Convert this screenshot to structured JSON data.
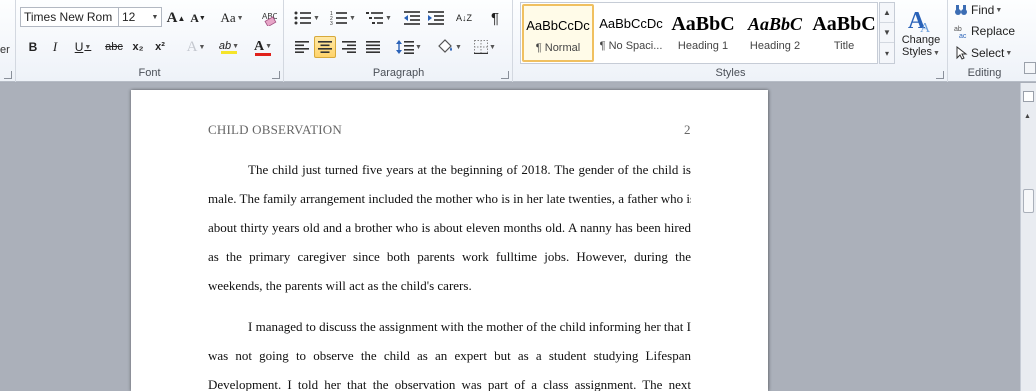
{
  "ribbon": {
    "partial_group": {
      "label_fragment": "er"
    },
    "font": {
      "group_label": "Font",
      "font_name": "Times New Rom",
      "font_size": "12",
      "grow_label": "A",
      "shrink_label": "A",
      "case_label": "Aa",
      "bold": "B",
      "italic": "I",
      "underline": "U",
      "strike": "abc",
      "subscript": "x₂",
      "superscript": "x²",
      "text_effects": "A",
      "highlight": "ab",
      "font_color": "A",
      "highlight_color": "#f5e42a",
      "font_color_bar": "#e0211b"
    },
    "paragraph": {
      "group_label": "Paragraph",
      "pilcrow": "¶",
      "sort": "A↓Z"
    },
    "styles": {
      "group_label": "Styles",
      "tiles": [
        {
          "preview": "AaBbCcDc",
          "name": "¶ Normal",
          "selected": true
        },
        {
          "preview": "AaBbCcDc",
          "name": "¶ No Spaci...",
          "selected": false
        },
        {
          "preview": "AaBbC",
          "name": "Heading 1",
          "selected": false
        },
        {
          "preview": "AaBbC",
          "name": "Heading 2",
          "selected": false
        },
        {
          "preview": "AaBbC",
          "name": "Title",
          "selected": false
        }
      ],
      "change_styles_line1": "Change",
      "change_styles_line2": "Styles"
    },
    "editing": {
      "group_label": "Editing",
      "find": "Find",
      "replace": "Replace",
      "select": "Select"
    }
  },
  "document": {
    "header_title": "CHILD OBSERVATION",
    "page_number": "2",
    "paragraphs": [
      {
        "lines": [
          "The child just turned five years at the beginning of 2018. The gender of the child is",
          "male. The family arrangement included the mother who is in her late twenties, a father who is",
          "about thirty years old and a brother who is about eleven months old. A nanny has been hired",
          "as the primary caregiver since both parents work fulltime jobs. However, during the",
          "weekends, the parents will act as the child's carers."
        ]
      },
      {
        "lines": [
          "I managed to discuss the assignment with the mother of the child informing her that I",
          "was not going to observe the child as an expert but as a student studying Lifespan",
          "Development. I told her that the observation was part of a class assignment. The next"
        ]
      }
    ]
  }
}
